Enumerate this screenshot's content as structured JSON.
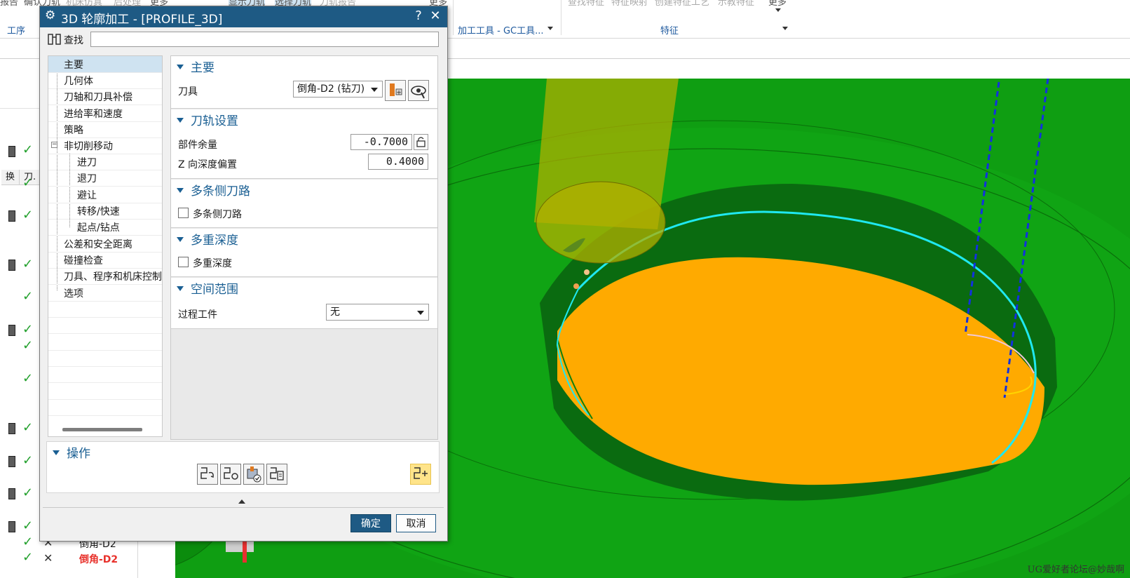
{
  "ribbon": {
    "top_items": [
      "报告",
      "确认刀轨",
      "机床仿真",
      "后处理",
      "更多",
      "显示刀轨",
      "选择刀轨",
      "刀轨报告",
      "更多",
      "查找特征",
      "特征映射",
      "创建特征工艺",
      "示教特征",
      "更多"
    ],
    "groups": {
      "operations": "工序",
      "machining_tools": "加工工具 - GC工具...",
      "features": "特征"
    }
  },
  "navigator": {
    "headers": [
      "换",
      "刀."
    ],
    "rows": [
      {
        "status": "check",
        "tool": ""
      },
      {
        "status": "check",
        "tool": ""
      },
      {
        "status": "check",
        "tool": ""
      },
      {
        "status": "check",
        "tool": ""
      },
      {
        "status": "check",
        "tool": ""
      },
      {
        "status": "check",
        "tool": ""
      },
      {
        "status": "check",
        "tool": ""
      },
      {
        "status": "check",
        "tool": ""
      },
      {
        "status": "check",
        "tool": ""
      },
      {
        "status": "check",
        "tool": ""
      },
      {
        "status": "check",
        "tool": ""
      },
      {
        "status": "check",
        "tool": ""
      },
      {
        "status": "cross",
        "tool": "倒角-D2"
      },
      {
        "status": "cross",
        "tool": "倒角-D2"
      }
    ]
  },
  "dialog": {
    "title": "3D 轮廓加工 - [PROFILE_3D]",
    "help": "?",
    "close": "✕",
    "find_label": "查找",
    "find_value": "",
    "tree": [
      {
        "label": "主要",
        "selected": true
      },
      {
        "label": "几何体"
      },
      {
        "label": "刀轴和刀具补偿"
      },
      {
        "label": "进给率和速度"
      },
      {
        "label": "策略"
      },
      {
        "label": "非切削移动",
        "expanded": true
      },
      {
        "label": "进刀"
      },
      {
        "label": "退刀"
      },
      {
        "label": "避让"
      },
      {
        "label": "转移/快速"
      },
      {
        "label": "起点/钻点"
      },
      {
        "label": "公差和安全距离"
      },
      {
        "label": "碰撞检查"
      },
      {
        "label": "刀具、程序和机床控制"
      },
      {
        "label": "选项"
      }
    ],
    "main": {
      "header": "主要",
      "tool_label": "刀具",
      "tool_value": "倒角-D2 (钻刀)"
    },
    "path_settings": {
      "header": "刀轨设置",
      "stock_label": "部件余量",
      "stock_value": "-0.7000",
      "z_offset_label": "Z 向深度偏置",
      "z_offset_value": "0.4000"
    },
    "multi_side": {
      "header": "多条侧刀路",
      "checkbox_label": "多条侧刀路",
      "checked": false
    },
    "multi_depth": {
      "header": "多重深度",
      "checkbox_label": "多重深度",
      "checked": false
    },
    "spatial": {
      "header": "空间范围",
      "ipw_label": "过程工件",
      "ipw_value": "无"
    },
    "operations": {
      "header": "操作"
    },
    "ok": "确定",
    "cancel": "取消"
  },
  "viewport": {
    "watermark": "UG爱好者论坛@妙哉啊",
    "colors": {
      "background": "#0f9e12",
      "pocket_wall": "#0a6b10",
      "floor": "#ffaa00",
      "toolpath": "#1fe8f0",
      "tool": "#b3b000",
      "vector": "#1230e0"
    }
  }
}
